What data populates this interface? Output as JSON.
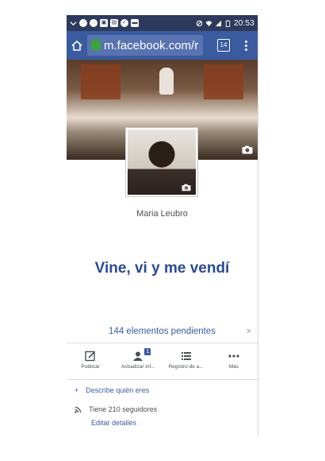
{
  "status_bar": {
    "time": "20:53",
    "battery_level": "5"
  },
  "browser": {
    "url": "m.facebook.com/r",
    "tab_count": "14"
  },
  "profile": {
    "name": "Maria Leubro",
    "headline": "Vine, vi y me vendí"
  },
  "pending": {
    "text": "144 elementos pendientes",
    "close": "×"
  },
  "actions": [
    {
      "label": "Publicar",
      "icon": "edit-icon"
    },
    {
      "label": "Actualizar inf...",
      "icon": "profile-update-icon",
      "badge": "1"
    },
    {
      "label": "Registro de a...",
      "icon": "activity-log-icon"
    },
    {
      "label": "Más",
      "icon": "more-icon"
    }
  ],
  "about": {
    "describe": "Describe quién eres",
    "followers": "Tiene 210 seguidores",
    "edit": "Editar detalles"
  },
  "colors": {
    "facebook_blue": "#3b5ba0",
    "status_bar": "#2d3a5d",
    "headline": "#2a4a94"
  }
}
